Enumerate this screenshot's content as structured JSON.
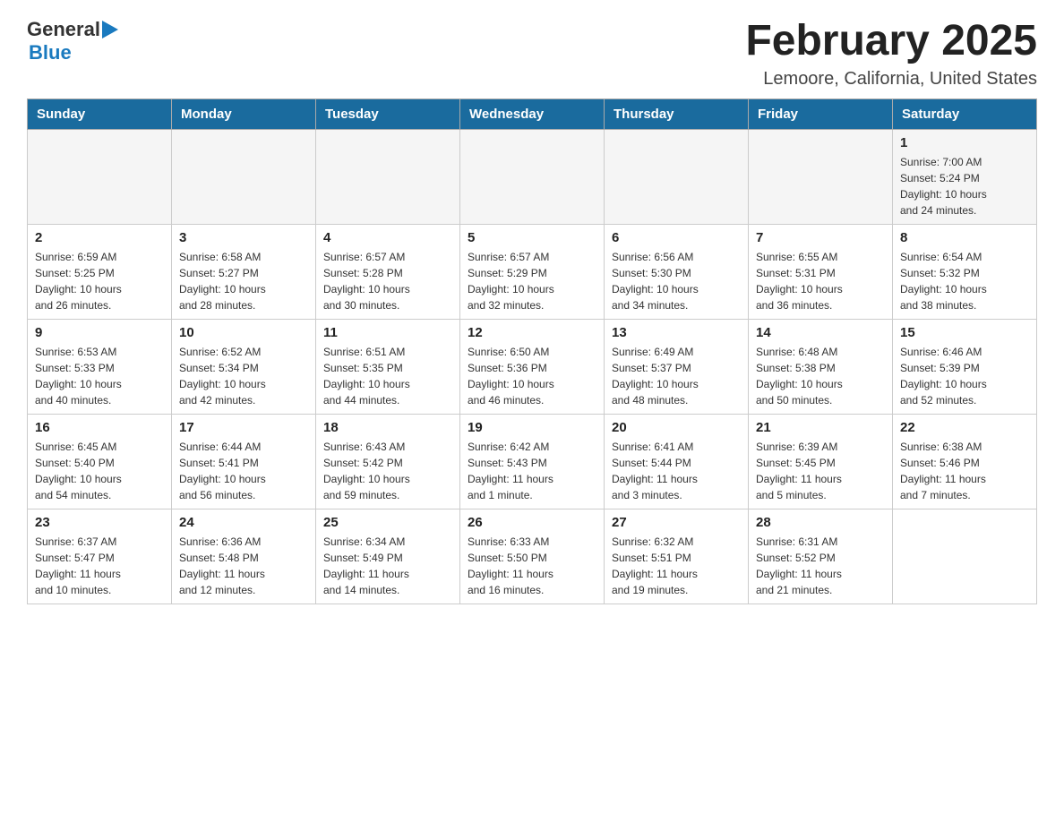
{
  "header": {
    "logo_general": "General",
    "logo_blue": "Blue",
    "title": "February 2025",
    "location": "Lemoore, California, United States"
  },
  "days_of_week": [
    "Sunday",
    "Monday",
    "Tuesday",
    "Wednesday",
    "Thursday",
    "Friday",
    "Saturday"
  ],
  "weeks": [
    [
      {
        "day": "",
        "info": ""
      },
      {
        "day": "",
        "info": ""
      },
      {
        "day": "",
        "info": ""
      },
      {
        "day": "",
        "info": ""
      },
      {
        "day": "",
        "info": ""
      },
      {
        "day": "",
        "info": ""
      },
      {
        "day": "1",
        "info": "Sunrise: 7:00 AM\nSunset: 5:24 PM\nDaylight: 10 hours\nand 24 minutes."
      }
    ],
    [
      {
        "day": "2",
        "info": "Sunrise: 6:59 AM\nSunset: 5:25 PM\nDaylight: 10 hours\nand 26 minutes."
      },
      {
        "day": "3",
        "info": "Sunrise: 6:58 AM\nSunset: 5:27 PM\nDaylight: 10 hours\nand 28 minutes."
      },
      {
        "day": "4",
        "info": "Sunrise: 6:57 AM\nSunset: 5:28 PM\nDaylight: 10 hours\nand 30 minutes."
      },
      {
        "day": "5",
        "info": "Sunrise: 6:57 AM\nSunset: 5:29 PM\nDaylight: 10 hours\nand 32 minutes."
      },
      {
        "day": "6",
        "info": "Sunrise: 6:56 AM\nSunset: 5:30 PM\nDaylight: 10 hours\nand 34 minutes."
      },
      {
        "day": "7",
        "info": "Sunrise: 6:55 AM\nSunset: 5:31 PM\nDaylight: 10 hours\nand 36 minutes."
      },
      {
        "day": "8",
        "info": "Sunrise: 6:54 AM\nSunset: 5:32 PM\nDaylight: 10 hours\nand 38 minutes."
      }
    ],
    [
      {
        "day": "9",
        "info": "Sunrise: 6:53 AM\nSunset: 5:33 PM\nDaylight: 10 hours\nand 40 minutes."
      },
      {
        "day": "10",
        "info": "Sunrise: 6:52 AM\nSunset: 5:34 PM\nDaylight: 10 hours\nand 42 minutes."
      },
      {
        "day": "11",
        "info": "Sunrise: 6:51 AM\nSunset: 5:35 PM\nDaylight: 10 hours\nand 44 minutes."
      },
      {
        "day": "12",
        "info": "Sunrise: 6:50 AM\nSunset: 5:36 PM\nDaylight: 10 hours\nand 46 minutes."
      },
      {
        "day": "13",
        "info": "Sunrise: 6:49 AM\nSunset: 5:37 PM\nDaylight: 10 hours\nand 48 minutes."
      },
      {
        "day": "14",
        "info": "Sunrise: 6:48 AM\nSunset: 5:38 PM\nDaylight: 10 hours\nand 50 minutes."
      },
      {
        "day": "15",
        "info": "Sunrise: 6:46 AM\nSunset: 5:39 PM\nDaylight: 10 hours\nand 52 minutes."
      }
    ],
    [
      {
        "day": "16",
        "info": "Sunrise: 6:45 AM\nSunset: 5:40 PM\nDaylight: 10 hours\nand 54 minutes."
      },
      {
        "day": "17",
        "info": "Sunrise: 6:44 AM\nSunset: 5:41 PM\nDaylight: 10 hours\nand 56 minutes."
      },
      {
        "day": "18",
        "info": "Sunrise: 6:43 AM\nSunset: 5:42 PM\nDaylight: 10 hours\nand 59 minutes."
      },
      {
        "day": "19",
        "info": "Sunrise: 6:42 AM\nSunset: 5:43 PM\nDaylight: 11 hours\nand 1 minute."
      },
      {
        "day": "20",
        "info": "Sunrise: 6:41 AM\nSunset: 5:44 PM\nDaylight: 11 hours\nand 3 minutes."
      },
      {
        "day": "21",
        "info": "Sunrise: 6:39 AM\nSunset: 5:45 PM\nDaylight: 11 hours\nand 5 minutes."
      },
      {
        "day": "22",
        "info": "Sunrise: 6:38 AM\nSunset: 5:46 PM\nDaylight: 11 hours\nand 7 minutes."
      }
    ],
    [
      {
        "day": "23",
        "info": "Sunrise: 6:37 AM\nSunset: 5:47 PM\nDaylight: 11 hours\nand 10 minutes."
      },
      {
        "day": "24",
        "info": "Sunrise: 6:36 AM\nSunset: 5:48 PM\nDaylight: 11 hours\nand 12 minutes."
      },
      {
        "day": "25",
        "info": "Sunrise: 6:34 AM\nSunset: 5:49 PM\nDaylight: 11 hours\nand 14 minutes."
      },
      {
        "day": "26",
        "info": "Sunrise: 6:33 AM\nSunset: 5:50 PM\nDaylight: 11 hours\nand 16 minutes."
      },
      {
        "day": "27",
        "info": "Sunrise: 6:32 AM\nSunset: 5:51 PM\nDaylight: 11 hours\nand 19 minutes."
      },
      {
        "day": "28",
        "info": "Sunrise: 6:31 AM\nSunset: 5:52 PM\nDaylight: 11 hours\nand 21 minutes."
      },
      {
        "day": "",
        "info": ""
      }
    ]
  ]
}
